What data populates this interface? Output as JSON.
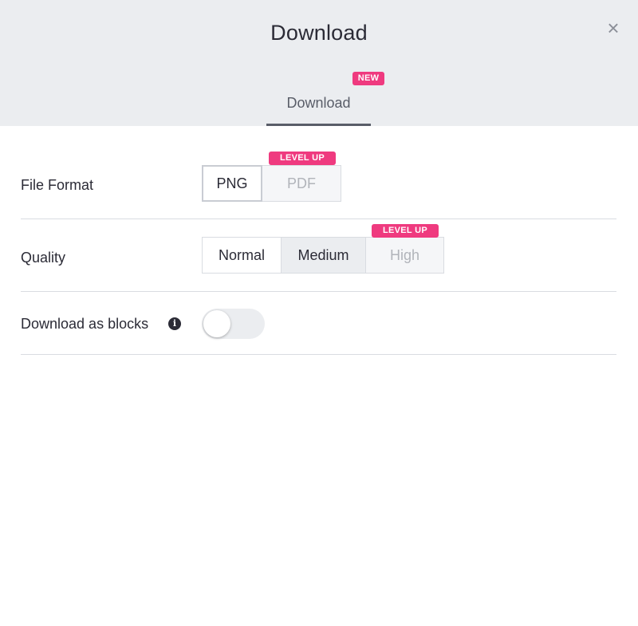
{
  "dialog": {
    "title": "Download",
    "close_symbol": "×",
    "tab": {
      "label": "Download",
      "badge": "NEW"
    }
  },
  "file_format": {
    "label": "File Format",
    "options": [
      {
        "label": "PNG",
        "state": "selected"
      },
      {
        "label": "PDF",
        "state": "locked",
        "badge": "LEVEL UP"
      }
    ]
  },
  "quality": {
    "label": "Quality",
    "options": [
      {
        "label": "Normal",
        "state": "default"
      },
      {
        "label": "Medium",
        "state": "selected"
      },
      {
        "label": "High",
        "state": "locked",
        "badge": "LEVEL UP"
      }
    ]
  },
  "blocks": {
    "label": "Download as blocks",
    "info_icon": "info-icon",
    "info_glyph": "i",
    "enabled": false
  },
  "colors": {
    "header_bg": "#ebedf0",
    "badge": "#ef3a7f",
    "text": "#2b2b36"
  }
}
